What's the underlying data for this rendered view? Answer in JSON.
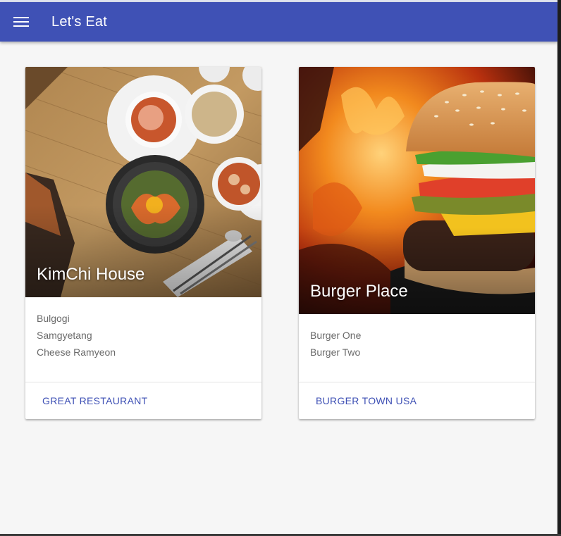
{
  "app": {
    "title": "Let's Eat",
    "accent_color": "#3f51b5",
    "menu_icon": "hamburger-menu-icon"
  },
  "cards": [
    {
      "title": "KimChi House",
      "image": "korean-food-photo",
      "items": [
        "Bulgogi",
        "Samgyetang",
        "Cheese Ramyeon"
      ],
      "action_label": "GREAT RESTAURANT"
    },
    {
      "title": "Burger Place",
      "image": "burger-fire-photo",
      "items": [
        "Burger One",
        "Burger Two"
      ],
      "action_label": "BURGER TOWN USA"
    }
  ]
}
